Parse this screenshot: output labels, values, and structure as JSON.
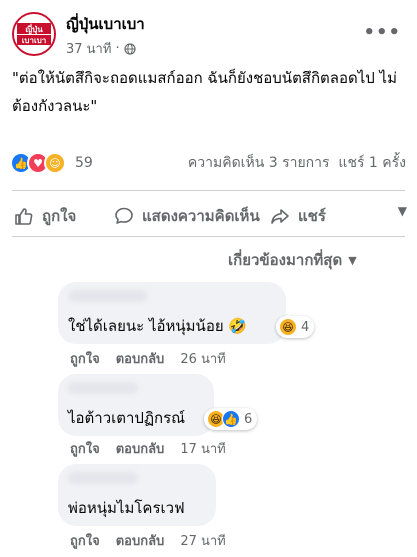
{
  "post": {
    "page_name": "ญี่ปุ่นเบาเบา",
    "time": "37 นาที",
    "audience_icon": "globe-icon",
    "more_icon": "more-icon",
    "avatar_logo_text": [
      "ญี่ปุ่น",
      "เบาเบา"
    ],
    "caption": "\"ต่อให้นัตสึกิจะถอดแมสก์ออก ฉันก็ยังชอบนัตสึกิตลอดไป ไม่ต้องกังวลนะ\""
  },
  "reactions": {
    "icons": [
      "like-icon",
      "love-icon",
      "care-icon"
    ],
    "count": "59",
    "comments_text": "ความคิดเห็น 3 รายการ",
    "shares_text": "แชร์ 1 ครั้ง"
  },
  "actions": {
    "like": "ถูกใจ",
    "comment": "แสดงความคิดเห็น",
    "share": "แชร์"
  },
  "sort_label": "เกี่ยวข้องมากที่สุด",
  "comments": [
    {
      "text": "ใช่ได้เลยนะ ไอ้หนุ่มน้อย 🤣",
      "reaction_icons": [
        "haha-icon"
      ],
      "reaction_count": "4",
      "like": "ถูกใจ",
      "reply": "ตอบกลับ",
      "time": "26 นาที"
    },
    {
      "text": "ไอต้าวเตาปฏิกรณ์",
      "reaction_icons": [
        "haha-icon",
        "like-icon"
      ],
      "reaction_count": "6",
      "like": "ถูกใจ",
      "reply": "ตอบกลับ",
      "time": "17 นาที"
    },
    {
      "text": "พ่อหนุ่มไมโครเวฟ",
      "reaction_icons": [],
      "reaction_count": "",
      "like": "ถูกใจ",
      "reply": "ตอบกลับ",
      "time": "27 นาที"
    }
  ],
  "colors": {
    "brand_red": "#c8102e",
    "like_blue": "#1877f2",
    "bubble_gray": "#f0f2f5",
    "secondary_text": "#65676b"
  }
}
